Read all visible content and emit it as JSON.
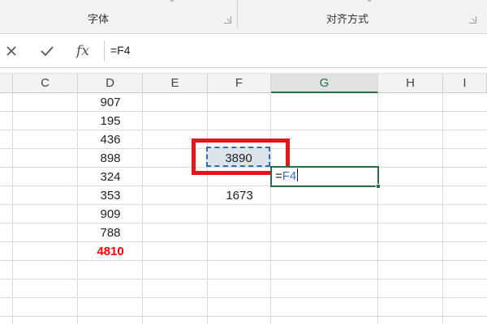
{
  "ribbon": {
    "groups": [
      {
        "label": "字体"
      },
      {
        "label": "对齐方式"
      }
    ]
  },
  "formula_bar": {
    "cancel_icon": "close-icon",
    "enter_icon": "check-icon",
    "function_label": "fx",
    "value": "=F4"
  },
  "columns": [
    "C",
    "D",
    "E",
    "F",
    "G",
    "H",
    "I"
  ],
  "active_column": "G",
  "cells": {
    "D": [
      "907",
      "195",
      "436",
      "898",
      "324",
      "353",
      "909",
      "788",
      "4810"
    ],
    "F4": "3890",
    "F6": "1673"
  },
  "editing_cell": {
    "prefix": "=",
    "reference": "F4"
  },
  "colors": {
    "accent_green": "#217346",
    "highlight_red": "#e0181e",
    "total_red": "#ff0000",
    "reference_blue": "#3a6fd8",
    "marching_ants_blue": "#2e6db5"
  }
}
